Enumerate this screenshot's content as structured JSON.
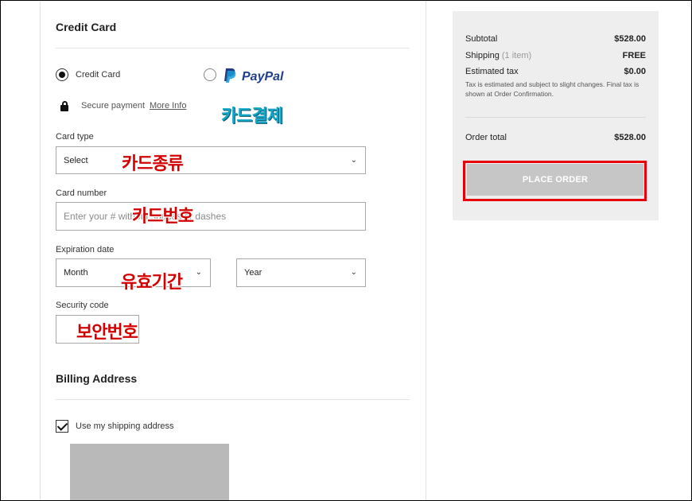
{
  "payment": {
    "title": "Credit Card",
    "option_credit_card": "Credit Card",
    "option_paypal": "PayPal",
    "secure_text": "Secure payment",
    "more_info": "More Info",
    "card_type_label": "Card type",
    "card_type_value": "Select",
    "card_number_label": "Card number",
    "card_number_placeholder": "Enter your # without spaces or dashes",
    "expiration_label": "Expiration date",
    "month_value": "Month",
    "year_value": "Year",
    "security_label": "Security code"
  },
  "billing": {
    "title": "Billing Address",
    "use_shipping_label": "Use my shipping address"
  },
  "summary": {
    "subtotal_label": "Subtotal",
    "subtotal_value": "$528.00",
    "shipping_label": "Shipping",
    "shipping_count": "(1 item)",
    "shipping_value": "FREE",
    "tax_label": "Estimated tax",
    "tax_value": "$0.00",
    "tax_note": "Tax is estimated and subject to slight changes. Final tax is shown at Order Confirmation.",
    "order_total_label": "Order total",
    "order_total_value": "$528.00",
    "place_order": "PLACE ORDER"
  },
  "annotations": {
    "card_payment": "카드결제",
    "card_type": "카드종류",
    "card_number": "카드번호",
    "expiration": "유효기간",
    "security": "보안번호"
  },
  "colors": {
    "annotation_red": "#d20000",
    "annotation_teal": "#12a7c8",
    "highlight_box": "#e8000b",
    "paypal_blue": "#1f3f8a"
  }
}
